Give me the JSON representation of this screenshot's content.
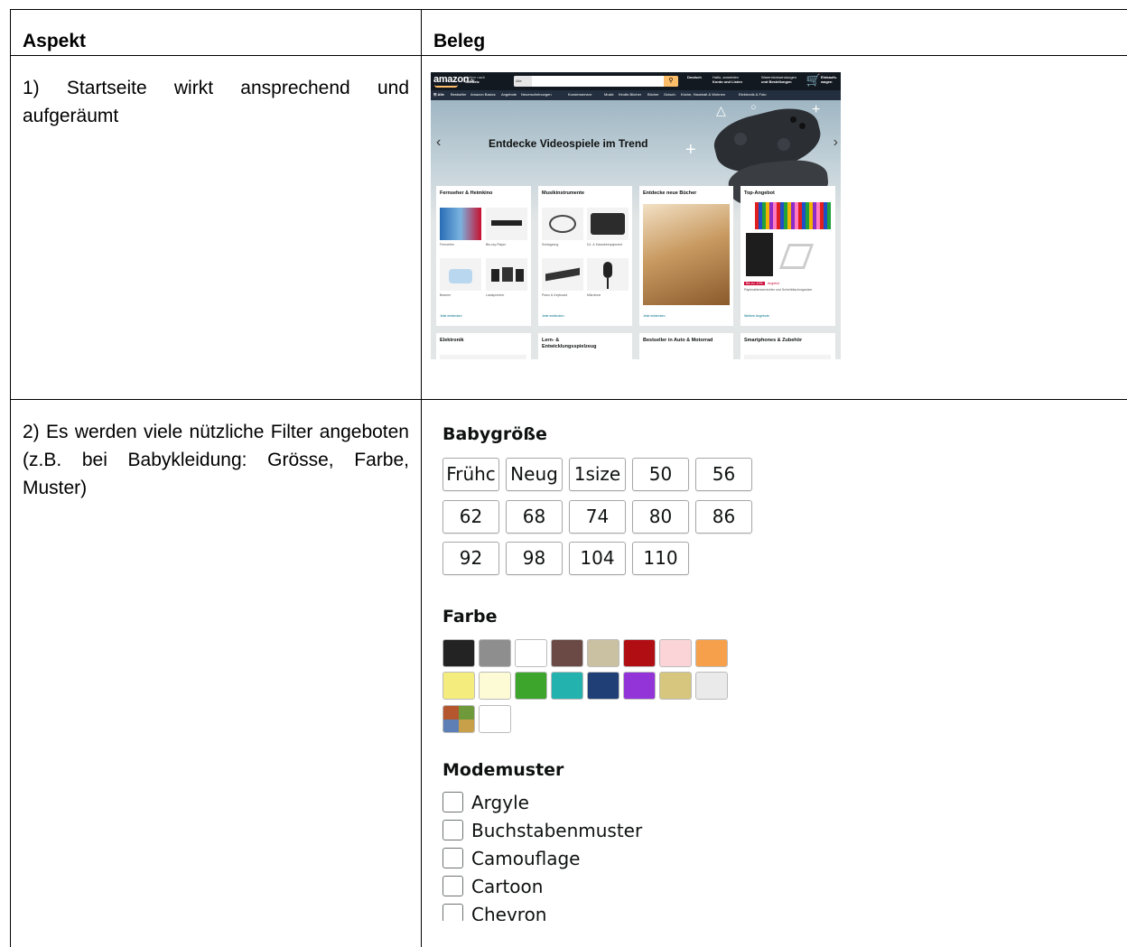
{
  "table": {
    "header_aspect": "Aspekt",
    "header_beleg": "Beleg",
    "row1_text": "1) Startseite wirkt ansprechend und aufgeräumt",
    "row2_text": "2) Es werden viele nützliche Filter angeboten (z.B. bei Babykleidung: Grösse, Farbe, Muster)"
  },
  "amazon": {
    "logo": "amazon",
    "logo_suffix": ".de",
    "location": [
      "Liefern nach",
      "Schweiz"
    ],
    "search_category": "Alle",
    "greeting": [
      "Hallo, anmelden",
      "Konto und Listen"
    ],
    "orders": [
      "Warenrücksendungen",
      "und Bestellungen"
    ],
    "cart": [
      "Einkaufs-",
      "wagen"
    ],
    "language": "Deutsch",
    "nav_items": [
      "☰ Alle",
      "Bestseller",
      "Amazon Basics",
      "Angebote",
      "Neuerscheinungen",
      "Kundenservice",
      "Musik",
      "Kindle-Bücher",
      "Bücher",
      "Gutsch.",
      "Küche, Haushalt & Wohnen",
      "Elektronik & Foto"
    ],
    "hero_title": "Entdecke Videospiele im Trend",
    "cards": [
      {
        "title": "Fernseher & Heimkino",
        "captions": [
          "Fernseher",
          "Blu-ray-Player",
          "Beamer",
          "Lautsprecher"
        ],
        "link": "Jetzt entdecken"
      },
      {
        "title": "Musikinstrumente",
        "captions": [
          "Schlagzeug",
          "DJ- & Karaokeequipment",
          "Piano & Keyboard",
          "Mikrofone"
        ],
        "link": "Jetzt entdecken"
      },
      {
        "title": "Entdecke neue Bücher",
        "captions": [],
        "link": "Jetzt entdecken"
      },
      {
        "title": "Top-Angebot",
        "captions": [
          "Papieraktenvernichter und Schreibtischorganizer"
        ],
        "deal": "Bis zu -10%",
        "deal_label": "Angebot",
        "link": "Weitere Angebote"
      }
    ],
    "cards_row2": [
      "Elektronik",
      "Lern- & Entwicklungsspielzeug",
      "Bestseller in Auto & Motorrad",
      "Smartphones & Zubehör"
    ]
  },
  "filters": {
    "size_title": "Babygröße",
    "sizes": [
      "Frühc",
      "Neug",
      "1size",
      "50",
      "56",
      "62",
      "68",
      "74",
      "80",
      "86",
      "92",
      "98",
      "104",
      "110"
    ],
    "color_title": "Farbe",
    "colors": [
      "#232323",
      "#8e8e8e",
      "#ffffff",
      "#6b4a45",
      "#c9c1a2",
      "#b10e14",
      "#fbd4d8",
      "#f7a04b",
      "#f5ec7e",
      "#fdfbd5",
      "#3da42c",
      "#24b2ae",
      "#1f3f76",
      "#9234d8",
      "#d6c67e",
      "#eaeaea",
      "multi",
      "#ffffff"
    ],
    "pattern_title": "Modemuster",
    "patterns": [
      "Argyle",
      "Buchstabenmuster",
      "Camouflage",
      "Cartoon",
      "Chevron"
    ]
  }
}
